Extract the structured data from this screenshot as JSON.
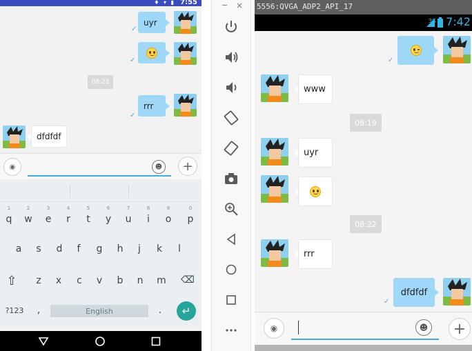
{
  "left_device": {
    "status": {
      "time": "7:55",
      "icons": "♦ ▾ ▮"
    },
    "messages": [
      {
        "dir": "out",
        "text": "uyr",
        "avatar": "goku-icon"
      },
      {
        "dir": "out",
        "emoji": "smiley-emoji-icon",
        "avatar": "goku-icon"
      },
      {
        "dir": "time",
        "text": "08:22"
      },
      {
        "dir": "out",
        "text": "rrr",
        "avatar": "goku-icon"
      },
      {
        "dir": "in",
        "text": "dfdfdf",
        "avatar": "goku-icon"
      }
    ],
    "keyboard": {
      "row1": [
        "q",
        "w",
        "e",
        "r",
        "t",
        "y",
        "u",
        "i",
        "o",
        "p"
      ],
      "row1_hints": [
        "1",
        "2",
        "3",
        "4",
        "5",
        "6",
        "7",
        "8",
        "9",
        "0"
      ],
      "row2": [
        "a",
        "s",
        "d",
        "f",
        "g",
        "h",
        "j",
        "k",
        "l"
      ],
      "row3": [
        "z",
        "x",
        "c",
        "v",
        "b",
        "n",
        "m"
      ],
      "sym_label": "?123",
      "comma": ",",
      "space_label": "English",
      "period": "."
    }
  },
  "strip": {
    "close": "×",
    "minimize": "−",
    "icons": [
      "power-icon",
      "volume-up-icon",
      "volume-down-icon",
      "rotate-left-icon",
      "rotate-right-icon",
      "camera-icon",
      "zoom-icon",
      "back-icon",
      "home-icon",
      "overview-icon",
      "more-icon"
    ]
  },
  "right_device": {
    "window_title": "5556:QVGA_ADP2_API_17",
    "status": {
      "time": "7:42",
      "network": "3G"
    },
    "messages": [
      {
        "dir": "out",
        "emoji": "wink-emoji-icon",
        "avatar": "goku-icon"
      },
      {
        "dir": "in",
        "text": "www",
        "avatar": "goku-icon"
      },
      {
        "dir": "time",
        "text": "08:19"
      },
      {
        "dir": "in",
        "text": "uyr",
        "avatar": "goku-icon"
      },
      {
        "dir": "in",
        "emoji": "smiley-emoji-icon",
        "avatar": "goku-icon"
      },
      {
        "dir": "time",
        "text": "08:22"
      },
      {
        "dir": "in",
        "text": "rrr",
        "avatar": "goku-icon"
      },
      {
        "dir": "out",
        "text": "dfdfdf",
        "avatar": "goku-icon"
      }
    ]
  },
  "colors": {
    "status_blue": "#3a4bc1",
    "bubble_out": "#9fd7f9",
    "accent": "#33b5e5",
    "enter_key": "#26a69a"
  }
}
